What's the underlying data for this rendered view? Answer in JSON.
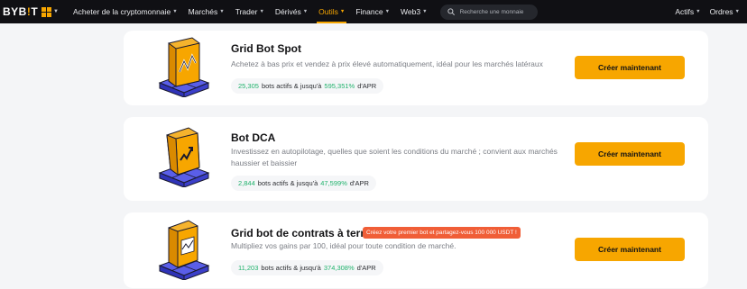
{
  "header": {
    "logo": {
      "text_main": "BYB",
      "text_accent": "!",
      "text_end": "T"
    },
    "apps_icon": "grid-apps-icon",
    "menu": [
      {
        "label": "Acheter de la cryptomonnaie",
        "has_dropdown": true,
        "active": false
      },
      {
        "label": "Marchés",
        "has_dropdown": true,
        "active": false
      },
      {
        "label": "Trader",
        "has_dropdown": true,
        "active": false
      },
      {
        "label": "Dérivés",
        "has_dropdown": true,
        "active": false
      },
      {
        "label": "Outils",
        "has_dropdown": true,
        "active": true
      },
      {
        "label": "Finance",
        "has_dropdown": true,
        "active": false
      },
      {
        "label": "Web3",
        "has_dropdown": true,
        "active": false
      }
    ],
    "search": {
      "placeholder": "Recherche une monnaie",
      "value": ""
    },
    "right_menu": [
      {
        "label": "Actifs",
        "has_dropdown": true
      },
      {
        "label": "Ordres",
        "has_dropdown": true
      }
    ]
  },
  "bots": [
    {
      "title": "Grid Bot Spot",
      "description": "Achetez à bas prix et vendez à prix élevé automatiquement, idéal pour les marchés latéraux",
      "stats": {
        "count": "25,305",
        "middle": "bots actifs & jusqu'à",
        "percent": "595,351%",
        "suffix": "d'APR"
      },
      "button": "Créer maintenant",
      "badge": ""
    },
    {
      "title": "Bot DCA",
      "description": "Investissez en autopilotage, quelles que soient les conditions du marché ; convient aux marchés haussier et baissier",
      "stats": {
        "count": "2,844",
        "middle": "bots actifs & jusqu'à",
        "percent": "47,599%",
        "suffix": "d'APR"
      },
      "button": "Créer maintenant",
      "badge": ""
    },
    {
      "title": "Grid bot de contrats à terme",
      "description": "Multipliez vos gains par 100, idéal pour toute condition de marché.",
      "stats": {
        "count": "11,203",
        "middle": "bots actifs & jusqu'à",
        "percent": "374,308%",
        "suffix": "d'APR"
      },
      "button": "Créer maintenant",
      "badge": "Créez votre premier bot et partagez-vous 100 000 USDT !"
    }
  ],
  "colors": {
    "accent": "#f7a600",
    "positive": "#20b26c",
    "badge": "#f05e37",
    "nav_bg": "#101014",
    "illustration_base": "#3b3fc9"
  }
}
